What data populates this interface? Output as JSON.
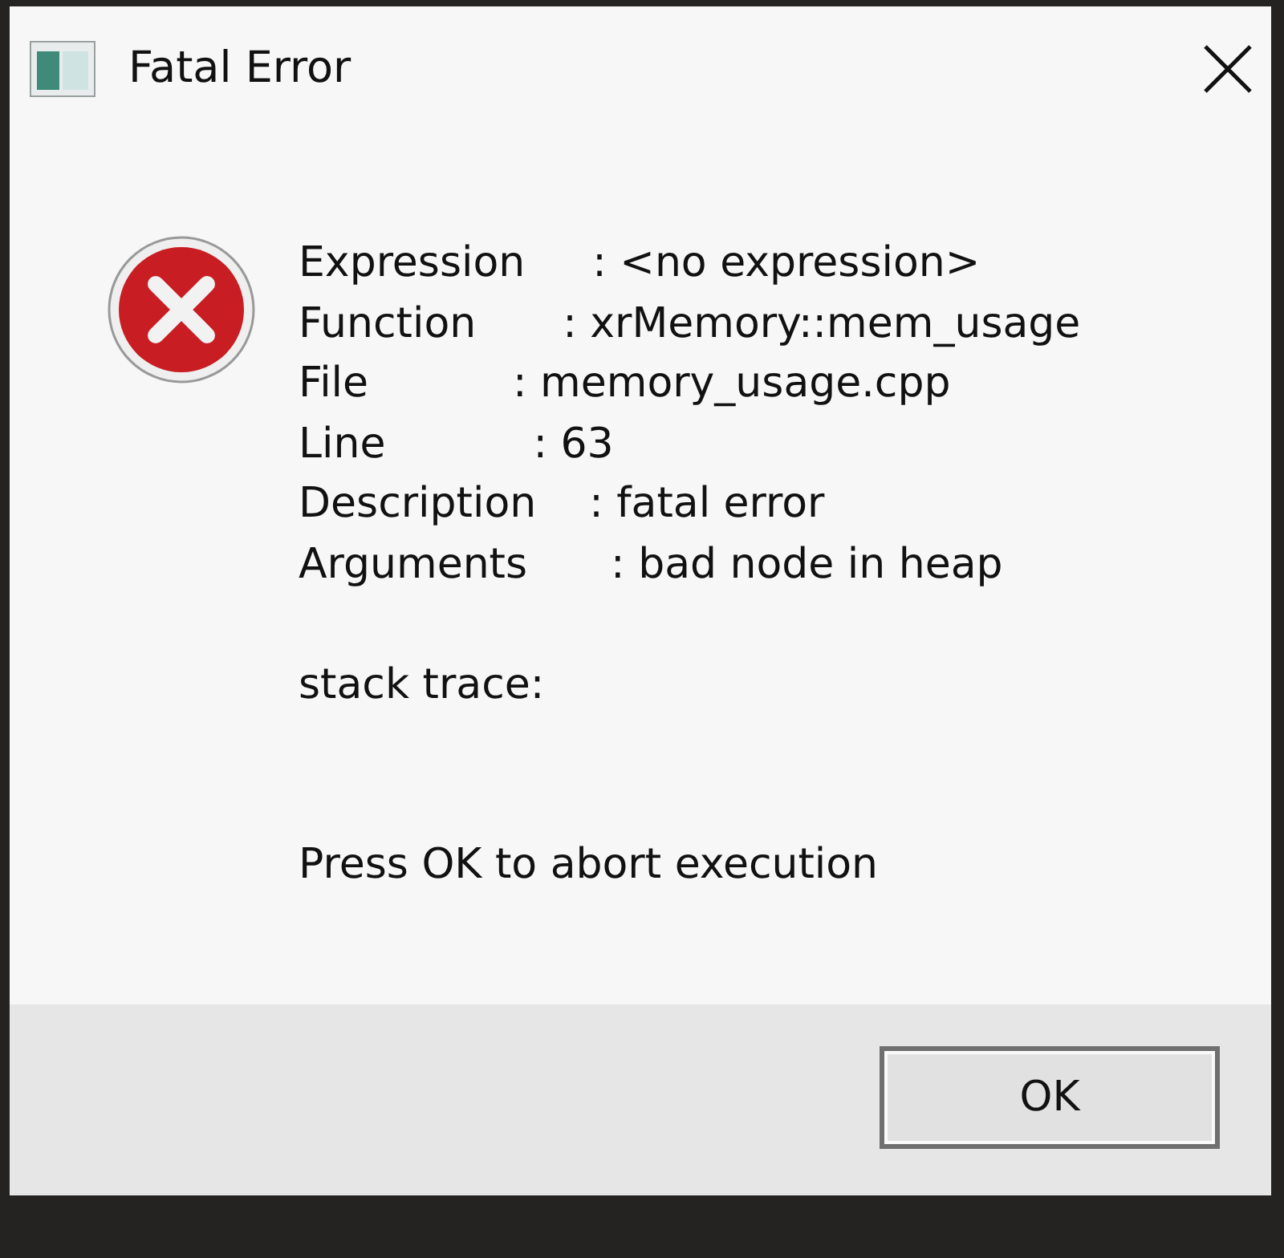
{
  "window": {
    "title": "Fatal Error"
  },
  "fields": [
    {
      "label": "Expression",
      "value": ": <no expression>"
    },
    {
      "label": "Function",
      "value": ": xrMemory::mem_usage"
    },
    {
      "label": "File",
      "value": ": memory_usage.cpp"
    },
    {
      "label": "Line",
      "value": ": 63"
    },
    {
      "label": "Description",
      "value": ": fatal error"
    },
    {
      "label": "Arguments",
      "value": ": bad node in heap"
    }
  ],
  "stack_trace": "stack trace:",
  "prompt": "Press OK to abort execution",
  "buttons": [
    "OK"
  ]
}
